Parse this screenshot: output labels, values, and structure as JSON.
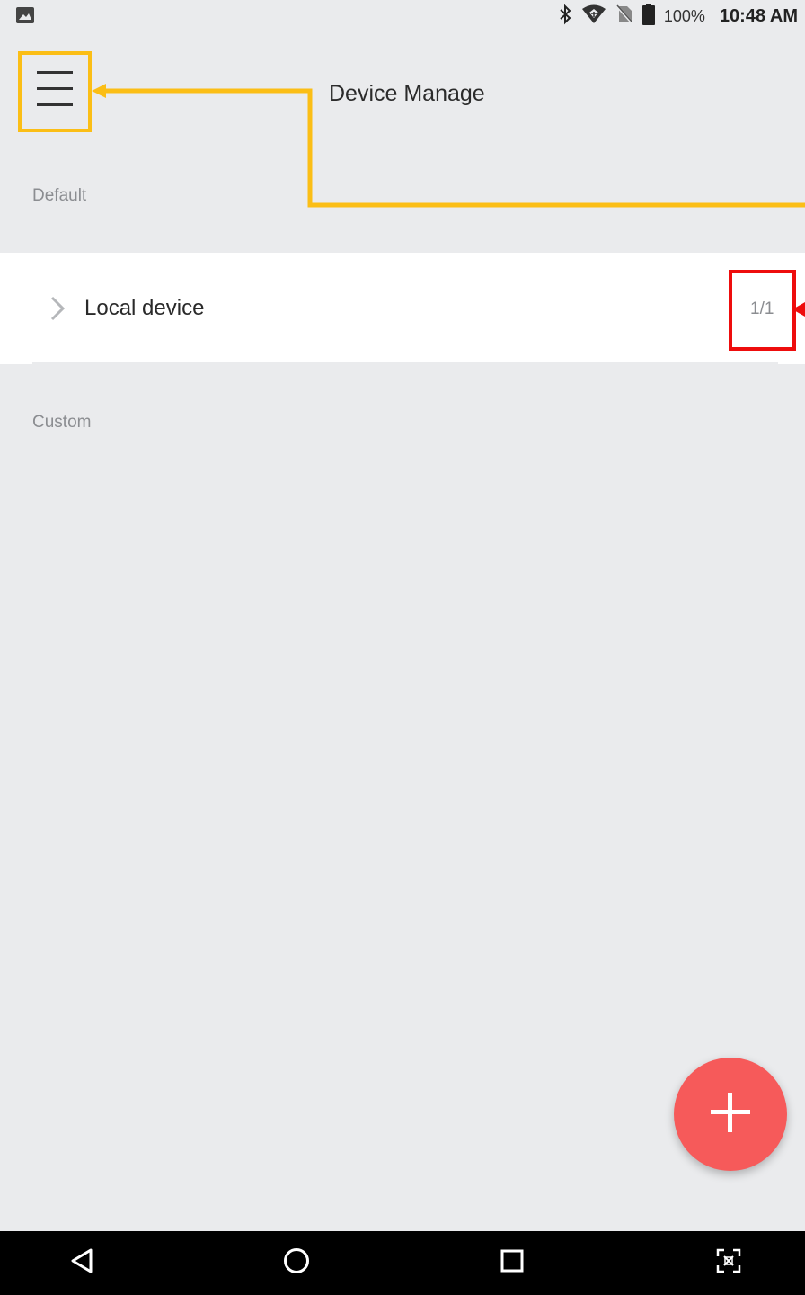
{
  "status_bar": {
    "notification_icon": "image-icon",
    "icons": [
      "bluetooth-icon",
      "wifi-icon",
      "no-sim-icon",
      "battery-icon"
    ],
    "battery_percent": "100%",
    "time": "10:48 AM"
  },
  "header": {
    "menu_icon": "hamburger-menu-icon",
    "title": "Device Manage"
  },
  "sections": {
    "default_label": "Default",
    "custom_label": "Custom"
  },
  "devices": [
    {
      "name": "Local device",
      "count": "1/1",
      "icon": "chevron-right-icon"
    }
  ],
  "fab": {
    "icon": "plus-icon"
  },
  "nav_bar": {
    "buttons": [
      "back-icon",
      "home-icon",
      "recents-icon",
      "screenshot-icon"
    ]
  },
  "colors": {
    "background": "#eaebed",
    "fab": "#f65a5a",
    "annotation_yellow": "#fbbe16",
    "annotation_red": "#ee0d0d"
  }
}
